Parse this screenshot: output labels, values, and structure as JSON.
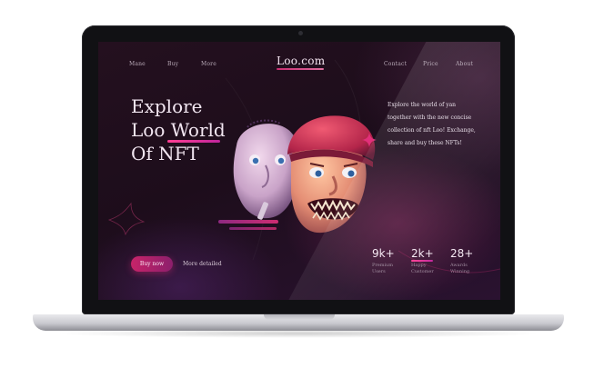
{
  "nav": {
    "left_links": [
      "Mane",
      "Buy",
      "More"
    ],
    "logo": "Loo.com",
    "right_links": [
      "Contact",
      "Price",
      "About"
    ]
  },
  "hero": {
    "title_lines": [
      "Explore",
      "Loo World",
      "Of NFT"
    ]
  },
  "description": {
    "line1": "Explore the world of yan",
    "line2_highlight": "together with",
    "line2_rest": " the new concise",
    "line3": "collection of nft Loo! Exchange,",
    "line4_start": "share ",
    "line4_highlight": "and buy these NFTs!"
  },
  "actions": {
    "buy_label": "Buy now",
    "more_label": "More detailed"
  },
  "stats": [
    {
      "value": "9k+",
      "label_line1": "Premium",
      "label_line2": "Users"
    },
    {
      "value": "2k+",
      "label_line1": "Happy",
      "label_line2": "Customer"
    },
    {
      "value": "28+",
      "label_line1": "Awards",
      "label_line2": "Winning"
    }
  ],
  "colors": {
    "accent": "#e7317f",
    "background": "#1f0e1d",
    "text": "#f2e6f1"
  },
  "icons": [
    "sparkle-icon",
    "thorn-decoration-icon"
  ]
}
